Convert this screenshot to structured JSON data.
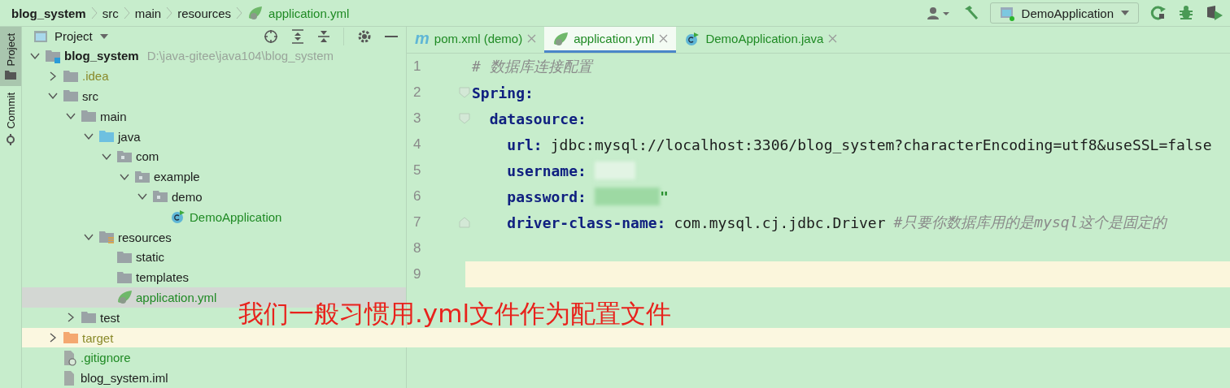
{
  "breadcrumb": [
    {
      "label": "blog_system",
      "kind": "project"
    },
    {
      "label": "src",
      "kind": "folder"
    },
    {
      "label": "main",
      "kind": "folder"
    },
    {
      "label": "resources",
      "kind": "folder"
    },
    {
      "label": "application.yml",
      "kind": "yml"
    }
  ],
  "toolbar": {
    "run_config": "DemoApplication"
  },
  "side_tabs": [
    {
      "label": "Project",
      "selected": true
    },
    {
      "label": "Commit",
      "selected": false
    }
  ],
  "project_panel": {
    "title": "Project",
    "tree": [
      {
        "name": "blog_system",
        "kind": "module",
        "path": "D:\\java-gitee\\java104\\blog_system",
        "expanded": true,
        "selected": false,
        "highlighted": false,
        "children": [
          {
            "name": ".idea",
            "kind": "folder",
            "color": "#8a8a2a",
            "expanded": false,
            "selected": false,
            "highlighted": false
          },
          {
            "name": "src",
            "kind": "folder",
            "expanded": true,
            "selected": false,
            "highlighted": false,
            "children": [
              {
                "name": "main",
                "kind": "folder",
                "expanded": true,
                "selected": false,
                "highlighted": false,
                "children": [
                  {
                    "name": "java",
                    "kind": "source",
                    "expanded": true,
                    "selected": false,
                    "highlighted": false,
                    "children": [
                      {
                        "name": "com",
                        "kind": "package",
                        "expanded": true,
                        "selected": false,
                        "highlighted": false,
                        "children": [
                          {
                            "name": "example",
                            "kind": "package",
                            "expanded": true,
                            "selected": false,
                            "highlighted": false,
                            "children": [
                              {
                                "name": "demo",
                                "kind": "package",
                                "expanded": true,
                                "selected": false,
                                "highlighted": false,
                                "children": [
                                  {
                                    "name": "DemoApplication",
                                    "kind": "class",
                                    "color": "#1f8a24",
                                    "selected": false,
                                    "highlighted": false
                                  }
                                ]
                              }
                            ]
                          }
                        ]
                      }
                    ]
                  },
                  {
                    "name": "resources",
                    "kind": "resources",
                    "expanded": true,
                    "selected": false,
                    "highlighted": false,
                    "children": [
                      {
                        "name": "static",
                        "kind": "folder",
                        "selected": false,
                        "highlighted": false
                      },
                      {
                        "name": "templates",
                        "kind": "folder",
                        "selected": false,
                        "highlighted": false
                      },
                      {
                        "name": "application.yml",
                        "kind": "yml",
                        "color": "#1f8a24",
                        "selected": true,
                        "highlighted": false
                      }
                    ]
                  }
                ]
              },
              {
                "name": "test",
                "kind": "folder",
                "expanded": false,
                "selected": false,
                "highlighted": false
              }
            ]
          },
          {
            "name": "target",
            "kind": "excluded",
            "color": "#8a8a2a",
            "expanded": false,
            "selected": false,
            "highlighted": true
          },
          {
            "name": ".gitignore",
            "kind": "ignorefile",
            "color": "#1f8a24",
            "selected": false,
            "highlighted": false
          },
          {
            "name": "blog_system.iml",
            "kind": "iml",
            "selected": false,
            "highlighted": false
          }
        ]
      }
    ]
  },
  "editor": {
    "tabs": [
      {
        "label": "pom.xml (demo)",
        "kind": "maven",
        "icon_text": "m",
        "selected": false
      },
      {
        "label": "application.yml",
        "kind": "yml",
        "selected": true
      },
      {
        "label": "DemoApplication.java",
        "kind": "class",
        "selected": false
      }
    ],
    "gutter": [
      {
        "number": "1",
        "current": false
      },
      {
        "number": "2",
        "current": false,
        "fold_start": true
      },
      {
        "number": "3",
        "current": false,
        "fold_start": true
      },
      {
        "number": "4",
        "current": false
      },
      {
        "number": "5",
        "current": false
      },
      {
        "number": "6",
        "current": false
      },
      {
        "number": "7",
        "current": false,
        "fold_end": true
      },
      {
        "number": "8",
        "current": false
      },
      {
        "number": "9",
        "current": true
      }
    ],
    "comment": "# 数据库连接配置",
    "yaml": [
      {
        "key": "Spring:",
        "children": [
          {
            "key": "datasource:",
            "children": [
              {
                "key": "url:",
                "value": "jdbc:mysql://localhost:3306/blog_system?characterEncoding=utf8&useSSL=false"
              },
              {
                "key": "username:",
                "redacted": true
              },
              {
                "key": "password:",
                "redacted": true,
                "value": "\""
              },
              {
                "key": "driver-class-name:",
                "value": "com.mysql.cj.jdbc.Driver",
                "comment": "#只要你数据库用的是mysql这个是固定的"
              }
            ]
          }
        ]
      }
    ]
  },
  "annotation": "我们一般习惯用.yml文件作为配置文件"
}
